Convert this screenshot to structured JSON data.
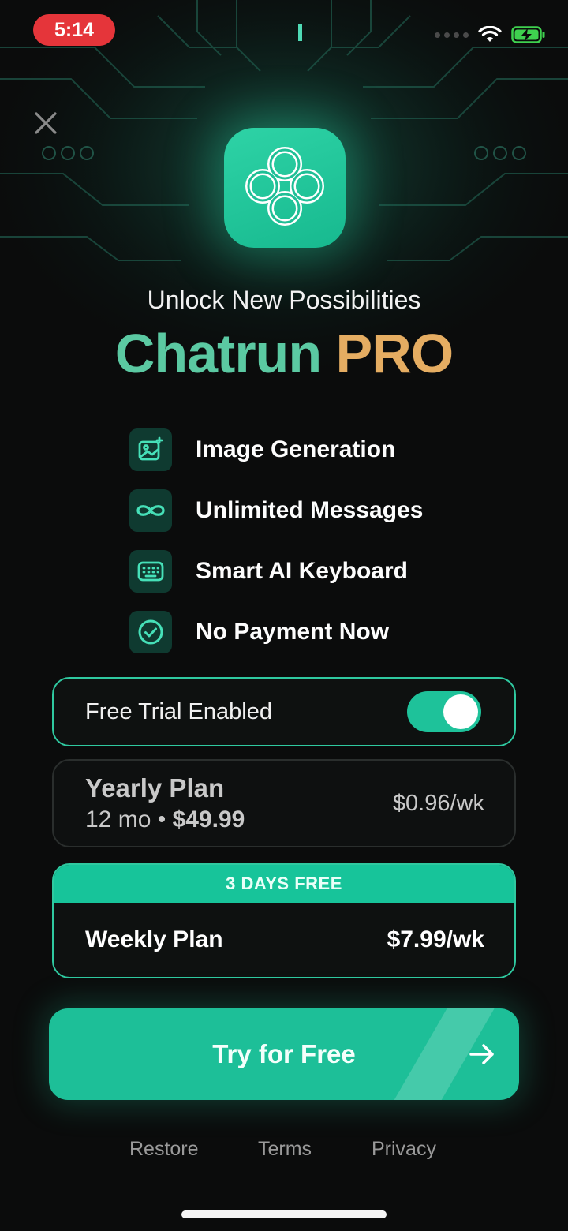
{
  "status_bar": {
    "time": "5:14",
    "icons": [
      "wifi-icon",
      "battery-charging-icon"
    ]
  },
  "close_icon": "close-icon",
  "app_icon": "knot-logo-icon",
  "headline": "Unlock New Possibilities",
  "brand": {
    "name": "Chatrun",
    "tier": "PRO",
    "name_color": "#5bc9a2",
    "tier_color": "#e5ad62"
  },
  "features": [
    {
      "label": "Image Generation",
      "icon": "image-sparkle-icon"
    },
    {
      "label": "Unlimited Messages",
      "icon": "infinity-icon"
    },
    {
      "label": "Smart AI Keyboard",
      "icon": "keyboard-icon"
    },
    {
      "label": "No Payment Now",
      "icon": "check-circle-icon"
    }
  ],
  "free_trial": {
    "label": "Free Trial Enabled",
    "enabled": true
  },
  "plans": {
    "yearly": {
      "title": "Yearly Plan",
      "duration": "12 mo",
      "separator": "•",
      "total": "$49.99",
      "per_week": "$0.96/wk",
      "selected": false
    },
    "weekly": {
      "badge": "3 DAYS FREE",
      "title": "Weekly Plan",
      "per_week": "$7.99/wk",
      "selected": true
    }
  },
  "cta": {
    "label": "Try for Free",
    "icon": "arrow-right-icon"
  },
  "footer": {
    "restore": "Restore",
    "terms": "Terms",
    "privacy": "Privacy"
  },
  "colors": {
    "accent": "#1dbf98",
    "background": "#0b0c0c"
  }
}
